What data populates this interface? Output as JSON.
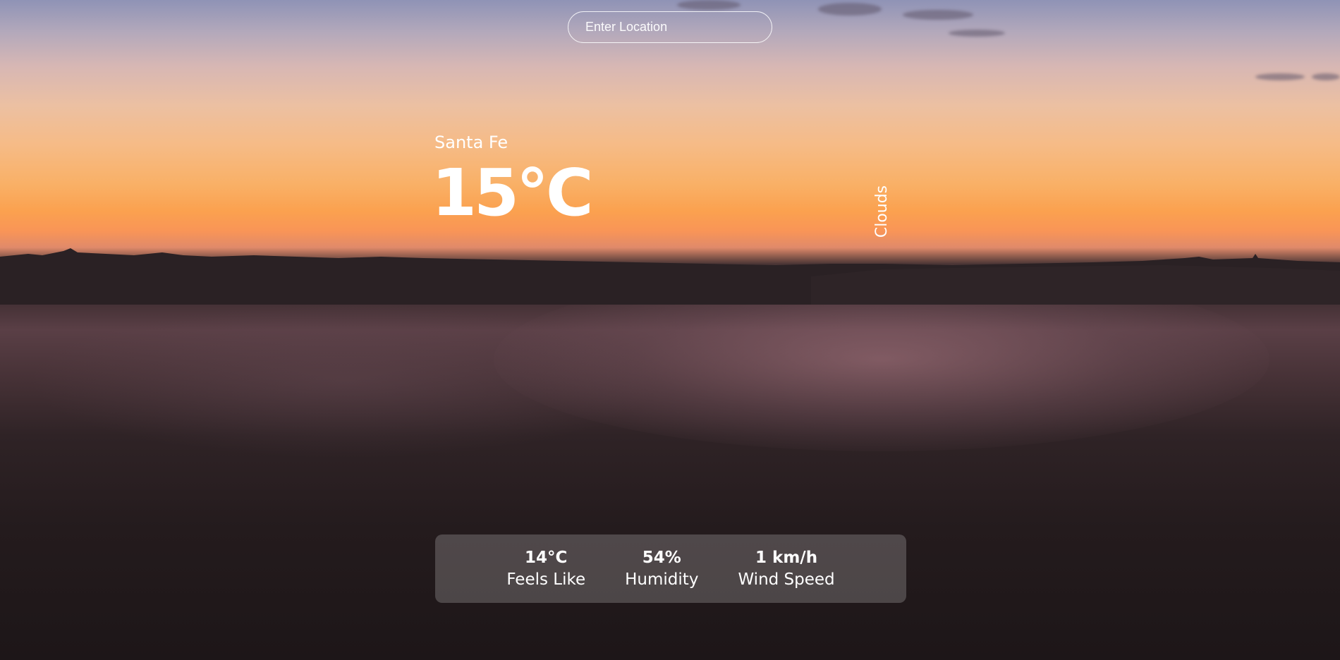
{
  "search": {
    "placeholder": "Enter Location",
    "value": ""
  },
  "weather": {
    "city": "Santa Fe",
    "temperature": "15°C",
    "condition": "Clouds"
  },
  "stats": [
    {
      "value": "14°C",
      "label": "Feels Like"
    },
    {
      "value": "54%",
      "label": "Humidity"
    },
    {
      "value": "1 km/h",
      "label": "Wind Speed"
    }
  ]
}
